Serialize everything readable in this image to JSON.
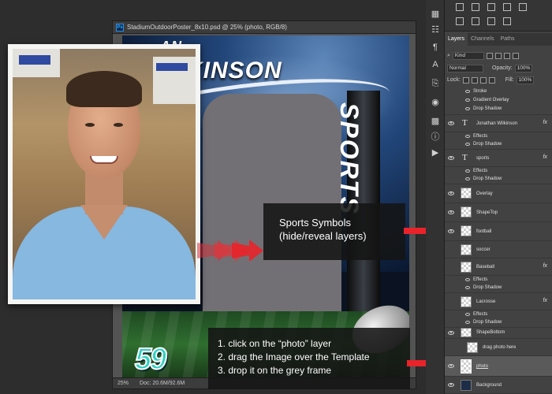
{
  "document": {
    "title": "StadiumOutdoorPoster_8x10.psd @ 25% (photo, RGB/8)",
    "app_badge": "Ps",
    "zoom": "25%",
    "doc_size": "Doc: 20.6M/92.6M"
  },
  "poster": {
    "name_line1": "AN",
    "name_line2": "KINSON",
    "sport_text": "SPORTS",
    "jersey_number": "59"
  },
  "callouts": {
    "symbols_line1": "Sports Symbols",
    "symbols_line2": "(hide/reveal layers)",
    "step1": "1. click on the “photo” layer",
    "step2": "2. drag the Image over the Template",
    "step3": "3. drop it on the grey frame"
  },
  "panel": {
    "tabs": [
      "Layers",
      "Channels",
      "Paths"
    ],
    "kind_label": "Kind",
    "blend_mode": "Normal",
    "opacity_label": "Opacity:",
    "opacity_value": "100%",
    "lock_label": "Lock:",
    "fill_label": "Fill:",
    "fill_value": "100%"
  },
  "layers": {
    "top_effects": [
      "Stroke",
      "Gradient Overlay",
      "Drop Shadow"
    ],
    "jonathan": {
      "name": "Jonathan  Wilkinson",
      "effects": "Effects",
      "drop": "Drop Shadow"
    },
    "sports": {
      "name": "sports",
      "effects": "Effects",
      "drop": "Drop Shadow"
    },
    "overlay": "Overlay",
    "shapetop": "ShapeTop",
    "football": "football",
    "soccer": "soccer",
    "baseball": {
      "name": "Baseball",
      "effects": "Effects",
      "drop": "Drop Shadow"
    },
    "lacrosse": {
      "name": "Lacrosse",
      "effects": "Effects",
      "drop": "Drop Shadow"
    },
    "shapebottom": "ShapeBottom",
    "drag_photo": "drag photo here",
    "photo": "photo",
    "background": "Background",
    "fx": "fx"
  },
  "colors": {
    "arrow_red": "#e8232a",
    "panel_bg": "#424242",
    "jersey_teal": "#2fd0c2",
    "frame_grey": "#727074"
  }
}
